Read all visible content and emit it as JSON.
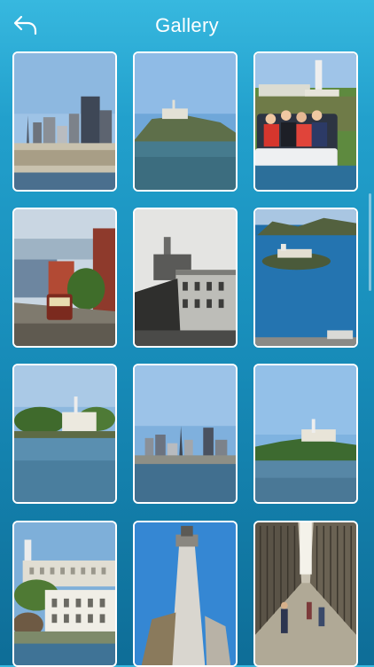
{
  "header": {
    "title": "Gallery",
    "back_icon": "back-arrow-icon"
  },
  "colors": {
    "background_top": "#37b8df",
    "background_bottom": "#0e6d97",
    "thumb_border": "#ffffff",
    "title_text": "#ffffff"
  },
  "gallery": {
    "photos": [
      {
        "subject": "city-skyline"
      },
      {
        "subject": "island-far"
      },
      {
        "subject": "boat-tour"
      },
      {
        "subject": "cable-car-street"
      },
      {
        "subject": "prison-building-bw"
      },
      {
        "subject": "island-aerial"
      },
      {
        "subject": "island-shore"
      },
      {
        "subject": "skyline-across-water"
      },
      {
        "subject": "island-lighthouse"
      },
      {
        "subject": "prison-buildings-closeup"
      },
      {
        "subject": "lighthouse-tower"
      },
      {
        "subject": "cellblock-corridor"
      }
    ]
  }
}
